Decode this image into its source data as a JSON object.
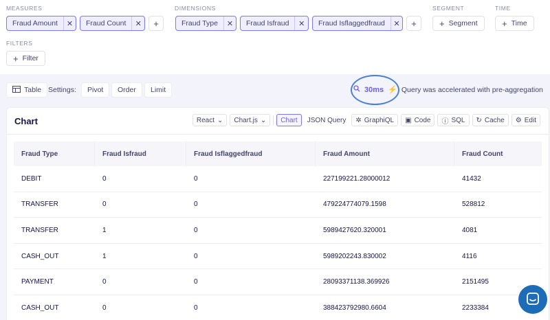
{
  "builder": {
    "measures": {
      "label": "MEASURES",
      "items": [
        "Fraud Amount",
        "Fraud Count"
      ]
    },
    "dimensions": {
      "label": "DIMENSIONS",
      "items": [
        "Fraud Type",
        "Fraud Isfraud",
        "Fraud Isflaggedfraud"
      ]
    },
    "segment": {
      "label": "SEGMENT",
      "button": "Segment"
    },
    "time": {
      "label": "TIME",
      "button": "Time"
    },
    "filters": {
      "label": "FILTERS",
      "button": "Filter"
    }
  },
  "toolbar": {
    "table_label": "Table",
    "settings_label": "Settings:",
    "pivot": "Pivot",
    "order": "Order",
    "limit": "Limit",
    "duration": "30ms",
    "accel_message": "Query was accelerated with pre-aggregation"
  },
  "card": {
    "title": "Chart",
    "framework": "React",
    "library": "Chart.js",
    "tabs": [
      "Chart",
      "JSON Query",
      "GraphiQL",
      "Code",
      "SQL",
      "Cache",
      "Edit"
    ]
  },
  "table": {
    "columns": [
      "Fraud Type",
      "Fraud Isfraud",
      "Fraud Isflaggedfraud",
      "Fraud Amount",
      "Fraud Count"
    ],
    "rows": [
      [
        "DEBIT",
        "0",
        "0",
        "227199221.28000012",
        "41432"
      ],
      [
        "TRANSFER",
        "0",
        "0",
        "479224774079.1598",
        "528812"
      ],
      [
        "TRANSFER",
        "1",
        "0",
        "5989427620.320001",
        "4081"
      ],
      [
        "CASH_OUT",
        "1",
        "0",
        "5989202243.830002",
        "4116"
      ],
      [
        "PAYMENT",
        "0",
        "0",
        "28093371138.369926",
        "2151495"
      ],
      [
        "CASH_OUT",
        "0",
        "0",
        "388423792980.6604",
        "2233384"
      ]
    ]
  }
}
